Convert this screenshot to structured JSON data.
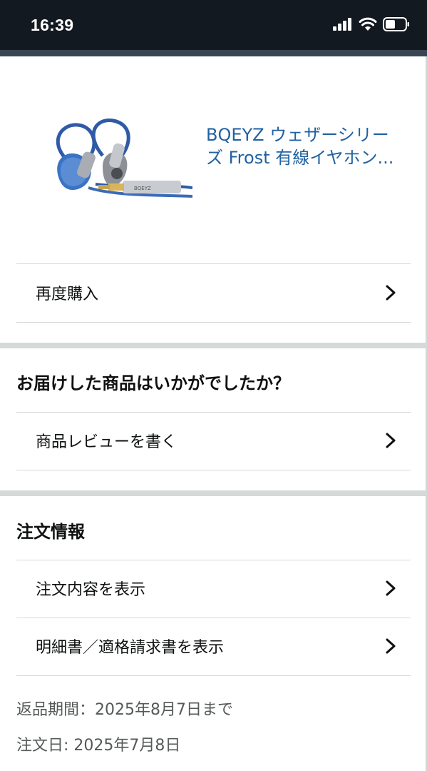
{
  "status_bar": {
    "time": "16:39",
    "icons": [
      "cellular-signal-icon",
      "wifi-icon",
      "battery-icon"
    ]
  },
  "product": {
    "title": "BQEYZ ウェザーシリーズ Frost 有線イヤホン...",
    "image_icon": "earphones-image"
  },
  "actions": {
    "buy_again": "再度購入"
  },
  "feedback": {
    "heading": "お届けした商品はいかがでしたか？",
    "write_review": "商品レビューを書く"
  },
  "order_info": {
    "heading": "注文情報",
    "view_order": "注文内容を表示",
    "view_invoice": "明細書／適格請求書を表示",
    "return_period": "返品期間：2025年8月7日まで",
    "order_date": "注文日: 2025年7月8日"
  },
  "colors": {
    "header": "#131921",
    "link": "#2162a1",
    "divider": "#d5d9d9",
    "muted_text": "#565959"
  }
}
